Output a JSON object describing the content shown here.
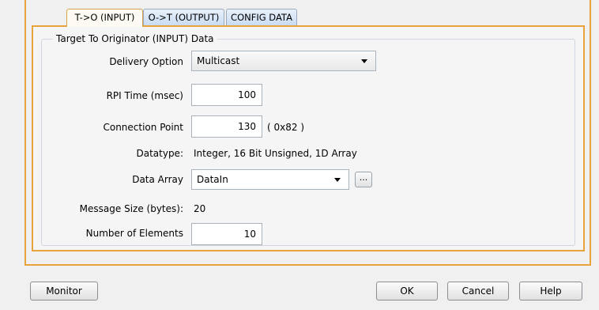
{
  "tabs": [
    {
      "label": "T->O (INPUT)",
      "active": true
    },
    {
      "label": "O->T (OUTPUT)",
      "active": false
    },
    {
      "label": "CONFIG DATA",
      "active": false
    }
  ],
  "group": {
    "title": "Target To Originator (INPUT) Data"
  },
  "form": {
    "delivery_option": {
      "label": "Delivery Option",
      "value": "Multicast"
    },
    "rpi_time": {
      "label": "RPI Time (msec)",
      "value": "100"
    },
    "connection_point": {
      "label": "Connection Point",
      "value": "130",
      "hex": "( 0x82 )"
    },
    "datatype": {
      "label": "Datatype:",
      "value": "Integer, 16 Bit Unsigned, 1D Array"
    },
    "data_array": {
      "label": "Data Array",
      "value": "DataIn",
      "browse_label": "..."
    },
    "message_size": {
      "label": "Message Size (bytes):",
      "value": "20"
    },
    "num_elements": {
      "label": "Number of Elements",
      "value": "10"
    }
  },
  "buttons": {
    "monitor": "Monitor",
    "ok": "OK",
    "cancel": "Cancel",
    "help": "Help"
  },
  "colors": {
    "accent_border": "#e8a33a",
    "tab_fill": "#c9dcf2"
  }
}
